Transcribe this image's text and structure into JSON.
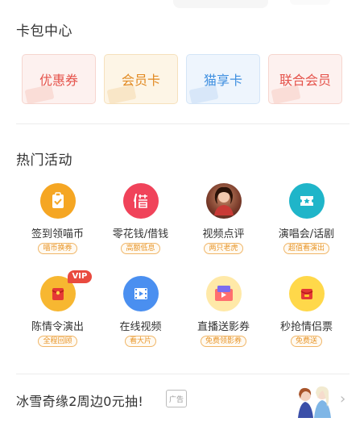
{
  "card_section": {
    "title": "卡包中心",
    "cards": [
      {
        "label": "优惠券"
      },
      {
        "label": "会员卡"
      },
      {
        "label": "猫享卡"
      },
      {
        "label": "联合会员"
      }
    ]
  },
  "hot_section": {
    "title": "热门活动",
    "items": [
      {
        "name": "签到领喵币",
        "tag": "喵币换券",
        "icon": "checklist-icon"
      },
      {
        "name": "零花钱/借钱",
        "tag": "高额低息",
        "icon": "borrow-icon"
      },
      {
        "name": "视频点评",
        "tag": "两只老虎",
        "icon": "video-review-avatar"
      },
      {
        "name": "演唱会/话剧",
        "tag": "超值看演出",
        "icon": "ticket-star-icon"
      },
      {
        "name": "陈情令演出",
        "tag": "全程回顾",
        "icon": "red-envelope-icon",
        "badge": "VIP"
      },
      {
        "name": "在线视频",
        "tag": "看大片",
        "icon": "film-play-icon"
      },
      {
        "name": "直播送影券",
        "tag": "免费领影券",
        "icon": "live-coupon-icon"
      },
      {
        "name": "秒抢情侣票",
        "tag": "免费送",
        "icon": "gift-envelope-icon"
      }
    ]
  },
  "ad": {
    "text": "冰雪奇缘2周边0元抽!",
    "badge": "广告"
  },
  "colors": {
    "red": "#e5534b",
    "orange": "#e28a22",
    "blue": "#3f8fe0",
    "tag_orange": "#e8962a"
  }
}
